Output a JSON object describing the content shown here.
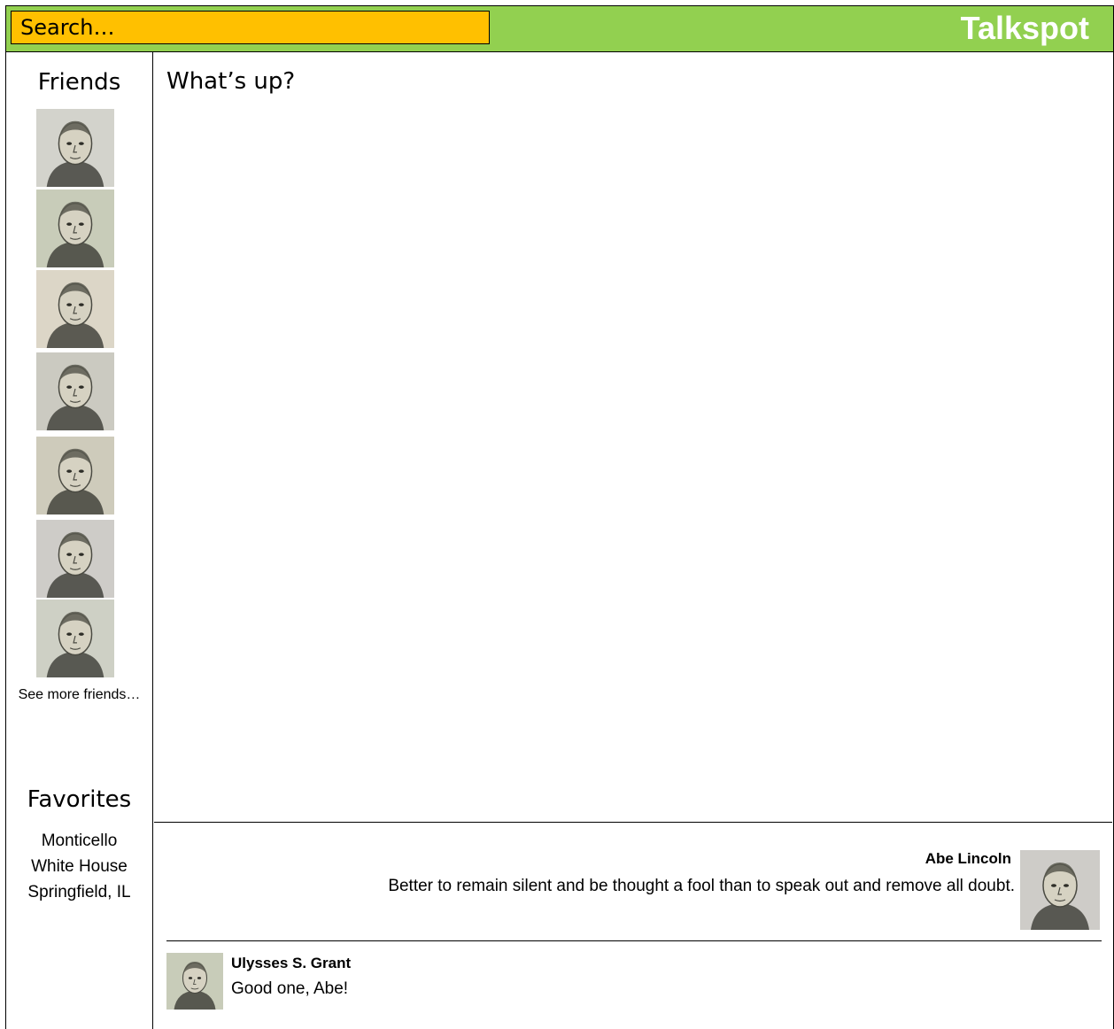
{
  "header": {
    "search_placeholder": "Search…",
    "brand": "Talkspot",
    "colors": {
      "bar": "#92d050",
      "search": "#ffc000",
      "brand_text": "#ffffff"
    }
  },
  "sidebar": {
    "friends_title": "Friends",
    "friends": [
      {
        "icon": "franklin-portrait",
        "tone": "#9a9c94"
      },
      {
        "icon": "grant-portrait",
        "tone": "#7c8a5e"
      },
      {
        "icon": "jackson-portrait",
        "tone": "#b4a685"
      },
      {
        "icon": "washington-portrait",
        "tone": "#858574"
      },
      {
        "icon": "hamilton-portrait",
        "tone": "#8d8665"
      },
      {
        "icon": "lincoln-portrait",
        "tone": "#8d8a86"
      },
      {
        "icon": "jefferson-portrait",
        "tone": "#8e9680"
      }
    ],
    "see_more": "See more friends…",
    "favorites_title": "Favorites",
    "favorites": [
      "Monticello",
      "White House",
      "Springfield, IL"
    ]
  },
  "compose": {
    "placeholder": "What’s up?"
  },
  "feed": [
    {
      "author": "Abe Lincoln",
      "text": "Better to remain silent and be thought a fool than to speak out and remove all doubt.",
      "avatar": "lincoln-portrait"
    },
    {
      "author": "Ulysses S. Grant",
      "text": "Good one, Abe!",
      "avatar": "grant-portrait"
    }
  ]
}
